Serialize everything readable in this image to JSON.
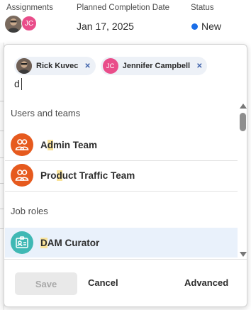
{
  "header": {
    "assignments_label": "Assignments",
    "assignee_initials": "JC",
    "completion_label": "Planned Completion Date",
    "completion_value": "Jan 17, 2025",
    "status_label": "Status",
    "status_value": "New",
    "status_color": "#1a6ee8"
  },
  "popover": {
    "chips": [
      {
        "name": "Rick Kuvec",
        "avatar": "photo",
        "remove_icon": "close-icon"
      },
      {
        "name": "Jennifer Campbell",
        "avatar_initials": "JC",
        "avatar_color": "#e94d8a",
        "remove_icon": "close-icon"
      }
    ],
    "search_value": "d",
    "sections": {
      "users_teams": "Users and teams",
      "job_roles": "Job roles"
    },
    "users_teams": [
      {
        "label_prefix": "A",
        "label_match": "d",
        "label_suffix": "min Team",
        "icon": "team-icon",
        "icon_color": "#e65a1e"
      },
      {
        "label_prefix": "Pro",
        "label_match": "d",
        "label_suffix": "uct Traffic Team",
        "icon": "team-icon",
        "icon_color": "#e65a1e"
      }
    ],
    "job_roles": [
      {
        "label_prefix": "",
        "label_match": "D",
        "label_suffix": "AM Curator",
        "icon": "job-role-icon",
        "icon_color": "#3fb8b4",
        "selected": true
      }
    ]
  },
  "footer": {
    "save_label": "Save",
    "cancel_label": "Cancel",
    "advanced_label": "Advanced"
  }
}
